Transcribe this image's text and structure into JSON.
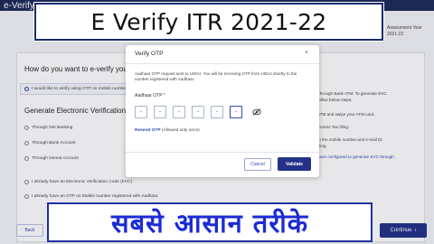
{
  "banner": {
    "title": "E Verify  ITR  2021-22"
  },
  "page": {
    "heading": "e-Verify Return",
    "top_right_1": "Assessment Year",
    "top_right_2": "2021-22",
    "question": "How do you want to e-verify your return?",
    "option_otp_aadhaar": "I would like to verify using OTP on mobile number registered with Aadhaar",
    "generate_title": "Generate Electronic Verification Code (EVC)",
    "options": [
      "Through Net Banking",
      "Through Bank Account",
      "Through Demat Account",
      "I already have an Electronic Verification Code (EVC)",
      "I already have an OTP on Mobile number registered with Aadhaar."
    ],
    "right_notes": [
      "Through Bank ATM. To generate EVC",
      "follow below steps:",
      "ATM and swipe your ATM card.",
      "income Tax filing.",
      "to the mobile number and e-mail ID",
      "filing.",
      "have configured to generate EVC through"
    ],
    "back_label": "Back",
    "continue_label": "Continue",
    "continue_arrow": "›"
  },
  "modal": {
    "title": "Verify OTP",
    "close_icon": "×",
    "info": "Aadhaar OTP request sent to UIDAI. You will be receiving OTP from UIDAI shortly to the number registered with Aadhaar.",
    "otp_label": "Aadhaar OTP",
    "required_mark": "*",
    "otp_digits": [
      "-",
      "-",
      "-",
      "-",
      "-",
      "-"
    ],
    "resend_link": "Resend OTP",
    "resend_note": " (Allowed only once)",
    "cancel_label": "Cancel",
    "validate_label": "Validate",
    "accent_color": "#24328a"
  },
  "hindi_banner": {
    "text": "सबसे आसान तरीके"
  }
}
